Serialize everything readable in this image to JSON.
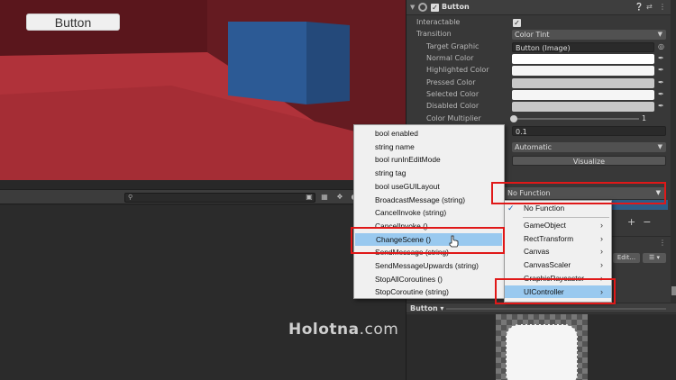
{
  "scene": {
    "game_button_label": "Button"
  },
  "inspector": {
    "component_title": "Button",
    "enabled": true,
    "rows": {
      "interactable": "Interactable",
      "transition": "Transition",
      "transition_value": "Color Tint",
      "target_graphic": "Target Graphic",
      "target_graphic_value": "Button (Image)",
      "normal_color": "Normal Color",
      "highlighted_color": "Highlighted Color",
      "pressed_color": "Pressed Color",
      "selected_color": "Selected Color",
      "disabled_color": "Disabled Color",
      "color_multiplier": "Color Multiplier",
      "color_multiplier_value": "1",
      "fade_duration_value": "0.1",
      "navigation_value": "Automatic",
      "visualize": "Visualize"
    },
    "event_function": "No Function",
    "edit_label": "Edit...",
    "preview_title": "Button"
  },
  "colors": {
    "normal": "#ffffff",
    "highlighted": "#f5f5f5",
    "pressed": "#c8c8c8",
    "selected": "#f5f5f5",
    "disabled": "#c8c8c8",
    "highlight_box": "#e01818",
    "menu_selection": "#99c9ef"
  },
  "property_menu": {
    "items": [
      "bool enabled",
      "string name",
      "bool runInEditMode",
      "string tag",
      "bool useGUILayout",
      "BroadcastMessage (string)",
      "CancelInvoke (string)",
      "CancelInvoke ()",
      "ChangeScene ()",
      "SendMessage (string)",
      "SendMessageUpwards (string)",
      "StopAllCoroutines ()",
      "StopCoroutine (string)"
    ],
    "selected": "ChangeScene ()"
  },
  "component_menu": {
    "items": [
      "No Function",
      "GameObject",
      "RectTransform",
      "Canvas",
      "CanvasScaler",
      "GraphicRaycaster",
      "UIController"
    ],
    "checked": "No Function",
    "selected": "UIController"
  },
  "watermark": {
    "brand": "Holotna",
    "suffix": ".com"
  }
}
